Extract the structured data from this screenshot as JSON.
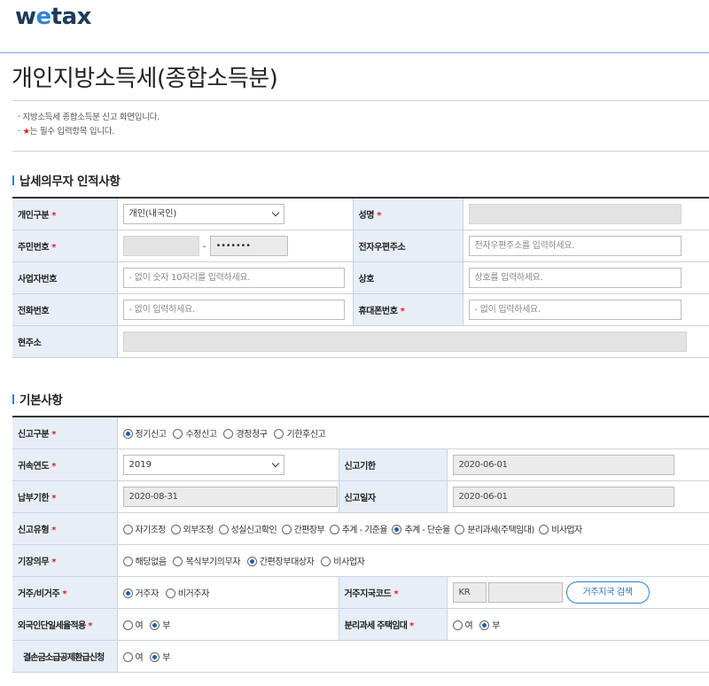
{
  "logo": {
    "pre": "w",
    "e": "e",
    "post": "tax"
  },
  "page": {
    "title": "개인지방소득세(종합소득분)"
  },
  "notice": {
    "line1": "· 지방소득세 종합소득분 신고 화면입니다.",
    "line2_prefix": "· ",
    "line2_star": "★",
    "line2_text": "는 필수 입력항목 입니다."
  },
  "section1": {
    "title": "납세의무자 인적사항",
    "person_type": {
      "label": "개인구분",
      "value": "개인(내국인)"
    },
    "name": {
      "label": "성명"
    },
    "rrn": {
      "label": "주민번호",
      "masked": "•••••••"
    },
    "email": {
      "label": "전자우편주소",
      "placeholder": "전자우편주소를 입력하세요."
    },
    "biz_no": {
      "label": "사업자번호",
      "placeholder": "- 없이 숫자 10자리를 입력하세요."
    },
    "company": {
      "label": "상호",
      "placeholder": "상호를 입력하세요."
    },
    "phone": {
      "label": "전화번호",
      "placeholder": "- 없이 입력하세요."
    },
    "mobile": {
      "label": "휴대폰번호",
      "placeholder": "- 없이 입력하세요."
    },
    "address": {
      "label": "현주소"
    }
  },
  "section2": {
    "title": "기본사항",
    "report_kind": {
      "label": "신고구분",
      "options": [
        "정기신고",
        "수정신고",
        "경정청구",
        "기한후신고"
      ],
      "selected": 0
    },
    "year": {
      "label": "귀속연도",
      "value": "2019"
    },
    "due": {
      "label": "신고기한",
      "value": "2020-06-01"
    },
    "pay_due": {
      "label": "납부기한",
      "value": "2020-08-31"
    },
    "report_date": {
      "label": "신고일자",
      "value": "2020-06-01"
    },
    "report_type": {
      "label": "신고유형",
      "options": [
        "자기조정",
        "외부조정",
        "성실신고확인",
        "간편장부",
        "추계 - 기준율",
        "추계 - 단순율",
        "분리과세(주택임대)",
        "비사업자"
      ],
      "selected": 5
    },
    "bookkeeping": {
      "label": "기장의무",
      "options": [
        "해당없음",
        "복식부기의무자",
        "간편장부대상자",
        "비사업자"
      ],
      "selected": 2
    },
    "residency": {
      "label": "거주/비거주",
      "options": [
        "거주자",
        "비거주자"
      ],
      "selected": 0
    },
    "country_code": {
      "label": "거주지국코드",
      "value": "KR",
      "button": "거주지국 검색"
    },
    "foreign_flat": {
      "label": "외국인단일세율적용",
      "options": [
        "여",
        "부"
      ],
      "selected": 1
    },
    "separate_rental": {
      "label": "분리과세 주택임대",
      "options": [
        "여",
        "부"
      ],
      "selected": 1
    },
    "loss_refund": {
      "label": "결손금소급공제환급신청",
      "options": [
        "여",
        "부"
      ],
      "selected": 1
    }
  },
  "colors": {
    "accent": "#2f7fd0",
    "label_bg": "#e8eef7",
    "required": "#e02020"
  }
}
